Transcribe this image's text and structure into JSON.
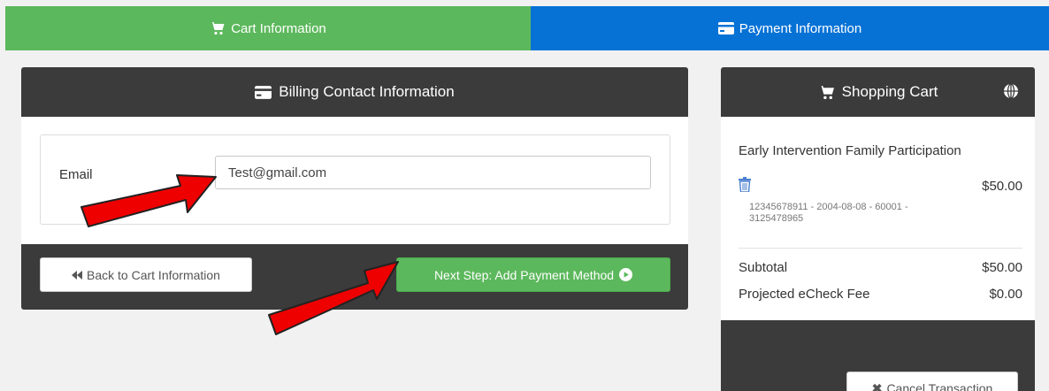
{
  "steps": {
    "cart_label": "Cart Information",
    "payment_label": "Payment Information"
  },
  "billing": {
    "title": "Billing Contact Information",
    "email_label": "Email",
    "email_value": "Test@gmail.com",
    "back_label": "Back to Cart Information",
    "next_label": "Next Step: Add Payment Method"
  },
  "cart": {
    "title": "Shopping Cart",
    "item": {
      "name": "Early Intervention Family Participation",
      "price": "$50.00",
      "detail": "12345678911 - 2004-08-08 - 60001 - 3125478965"
    },
    "subtotal_label": "Subtotal",
    "subtotal_value": "$50.00",
    "fee_label": "Projected eCheck Fee",
    "fee_value": "$0.00",
    "cancel_label": "Cancel Transaction"
  },
  "colors": {
    "step_cart": "#5cb85c",
    "step_payment": "#0672d6",
    "panel_dark": "#3b3b3b",
    "arrow": "#ee0000"
  },
  "icons": [
    "cart-icon",
    "credit-card-icon",
    "globe-icon",
    "trash-icon",
    "backward-icon",
    "play-circle-icon",
    "close-icon",
    "arrow-annotation"
  ]
}
